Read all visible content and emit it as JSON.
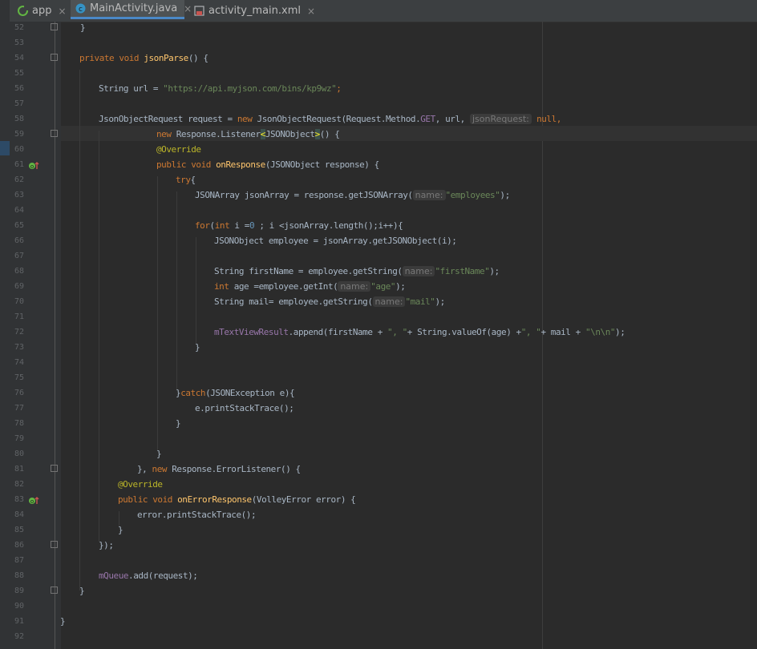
{
  "tabs": [
    {
      "label": "app",
      "icon": "android-module-icon"
    },
    {
      "label": "MainActivity.java",
      "icon": "java-class-icon",
      "active": true
    },
    {
      "label": "activity_main.xml",
      "icon": "xml-layout-icon"
    }
  ],
  "close_glyph": "×",
  "line_numbers": [
    "52",
    "53",
    "54",
    "55",
    "56",
    "57",
    "58",
    "59",
    "60",
    "61",
    "62",
    "63",
    "64",
    "65",
    "66",
    "67",
    "68",
    "69",
    "70",
    "71",
    "72",
    "73",
    "74",
    "75",
    "76",
    "77",
    "78",
    "79",
    "80",
    "81",
    "82",
    "83",
    "84",
    "85",
    "86",
    "87",
    "88",
    "89",
    "90",
    "91",
    "92"
  ],
  "code": {
    "l52": "}",
    "l54": {
      "kw1": "private",
      "kw2": "void",
      "method": "jsonParse",
      "rest": "() {"
    },
    "l56": {
      "decl": "String url = ",
      "str": "\"https://api.myjson.com/bins/kp9wz\"",
      "end": ";"
    },
    "l58": {
      "a": "JsonObjectRequest request = ",
      "kw": "new",
      "b": " JsonObjectRequest(Request.Method.",
      "field": "GET",
      "c": ", url, ",
      "hint": "jsonRequest:",
      "kw2": "null",
      "d": ","
    },
    "l59": {
      "kw": "new",
      "a": " Response.Listener",
      "lt": "<",
      "type": "JSONObject",
      "gt": ">",
      "b": "() {"
    },
    "l60": "@Override",
    "l61": {
      "kw1": "public",
      "kw2": "void",
      "method": "onResponse",
      "rest": "(JSONObject response) {"
    },
    "l62": {
      "kw": "try",
      "rest": "{"
    },
    "l63": {
      "a": "JSONArray jsonArray = response.getJSONArray(",
      "hint": "name:",
      "str": "\"employees\"",
      "end": ");"
    },
    "l65": {
      "kw1": "for",
      "a": "(",
      "kw2": "int",
      "b": " i =",
      "num": "0",
      "c": " ; i <jsonArray.length();i++){"
    },
    "l66": "JSONObject employee = jsonArray.getJSONObject(i);",
    "l68": {
      "a": "String firstName = employee.getString(",
      "hint": "name:",
      "str": "\"firstName\"",
      "end": ");"
    },
    "l69": {
      "kw": "int",
      "a": " age =employee.getInt(",
      "hint": "name:",
      "str": "\"age\"",
      "end": ");"
    },
    "l70": {
      "a": "String mail= employee.getString(",
      "hint": "name:",
      "str": "\"mail\"",
      "end": ");"
    },
    "l72": {
      "field": "mTextViewResult",
      "a": ".append(firstName + ",
      "s1": "\", \"",
      "b": "+ String.valueOf(age) +",
      "s2": "\", \"",
      "c": "+ mail + ",
      "s3": "\"\\n\\n\"",
      "end": ");"
    },
    "l73": "}",
    "l76": {
      "a": "}",
      "kw": "catch",
      "b": "(JSONException e){"
    },
    "l77": "e.printStackTrace();",
    "l78": "}",
    "l80": "}",
    "l81": {
      "a": "}, ",
      "kw": "new",
      "b": " Response.ErrorListener() {"
    },
    "l82": "@Override",
    "l83": {
      "kw1": "public",
      "kw2": "void",
      "method": "onErrorResponse",
      "rest": "(VolleyError error) {"
    },
    "l84": "error.printStackTrace();",
    "l85": "}",
    "l86": "});",
    "l88": {
      "field": "mQueue",
      "rest": ".add(request);"
    },
    "l89": "}",
    "l91": "}"
  }
}
